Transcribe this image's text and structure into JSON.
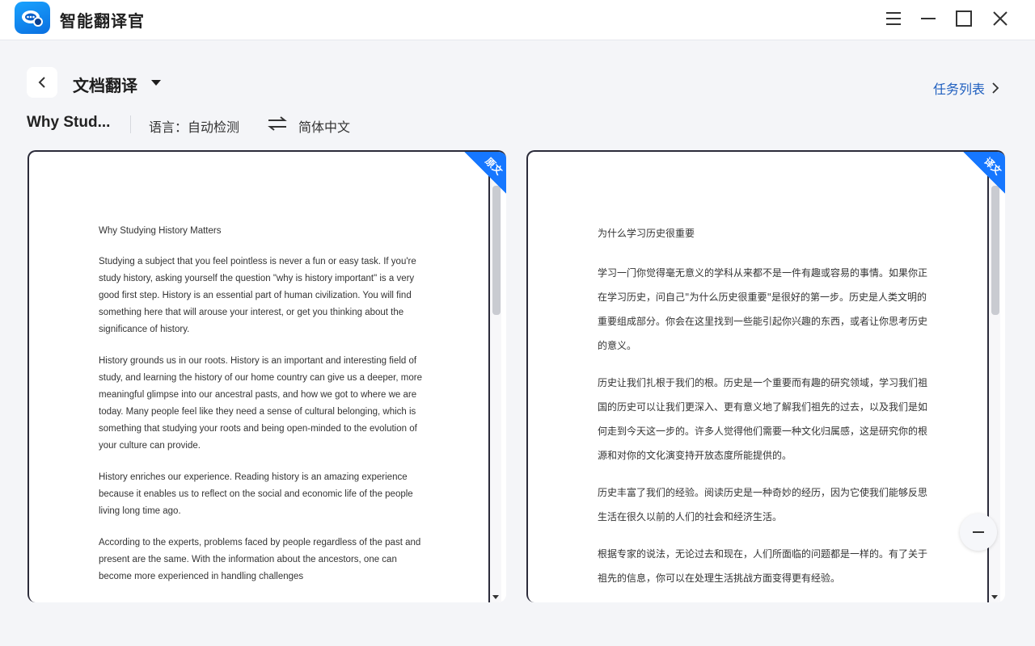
{
  "app": {
    "title": "智能翻译官"
  },
  "header": {
    "mode": "文档翻译",
    "task_list": "任务列表"
  },
  "info": {
    "file_name": "Why Stud...",
    "language_label": "语言：自动检测",
    "target_language": "简体中文"
  },
  "colors": {
    "accent": "#1677ff",
    "link": "#1f5fbf"
  },
  "icons": {
    "logo": "app-logo-icon",
    "menu": "menu-icon",
    "minimize": "minimize-icon",
    "maximize": "maximize-icon",
    "close": "close-icon",
    "back": "chevron-left-icon",
    "caret": "caret-down-icon",
    "swap": "swap-icon",
    "task_arrow": "chevron-right-icon",
    "zoom_out": "minus-icon"
  },
  "original": {
    "badge": "原文",
    "title": "Why Studying History Matters",
    "paragraphs": [
      "Studying a subject that you feel pointless is never a fun or easy task. If you're study history, asking yourself the question \"why is history important\" is a very good first step. History is an essential part of human civilization. You will find something here that will arouse your interest, or get you thinking about the significance of history.",
      "History grounds us in our roots. History is an important and interesting field of study, and learning the history of our home country can give us a deeper, more meaningful glimpse into our ancestral pasts, and how we got to where we are today. Many people feel like they need a sense of cultural belonging, which is something that studying your roots and being open-minded to the evolution of your culture can provide.",
      "History enriches our experience. Reading history is an amazing experience because it enables us to reflect on the social and economic life of the people living long time ago.",
      "According to the experts, problems faced by people regardless of the past and present are the same. With the information about the ancestors, one can become more experienced in handling challenges"
    ]
  },
  "translation": {
    "badge": "译文",
    "title": "为什么学习历史很重要",
    "paragraphs": [
      "学习一门你觉得毫无意义的学科从来都不是一件有趣或容易的事情。如果你正在学习历史，问自己\"为什么历史很重要\"是很好的第一步。历史是人类文明的重要组成部分。你会在这里找到一些能引起你兴趣的东西，或者让你思考历史的意义。",
      "历史让我们扎根于我们的根。历史是一个重要而有趣的研究领域，学习我们祖国的历史可以让我们更深入、更有意义地了解我们祖先的过去，以及我们是如何走到今天这一步的。许多人觉得他们需要一种文化归属感，这是研究你的根源和对你的文化演变持开放态度所能提供的。",
      "历史丰富了我们的经验。阅读历史是一种奇妙的经历，因为它使我们能够反思生活在很久以前的人们的社会和经济生活。",
      "根据专家的说法，无论过去和现在，人们所面临的问题都是一样的。有了关于祖先的信息，你可以在处理生活挑战方面变得更有经验。"
    ]
  }
}
